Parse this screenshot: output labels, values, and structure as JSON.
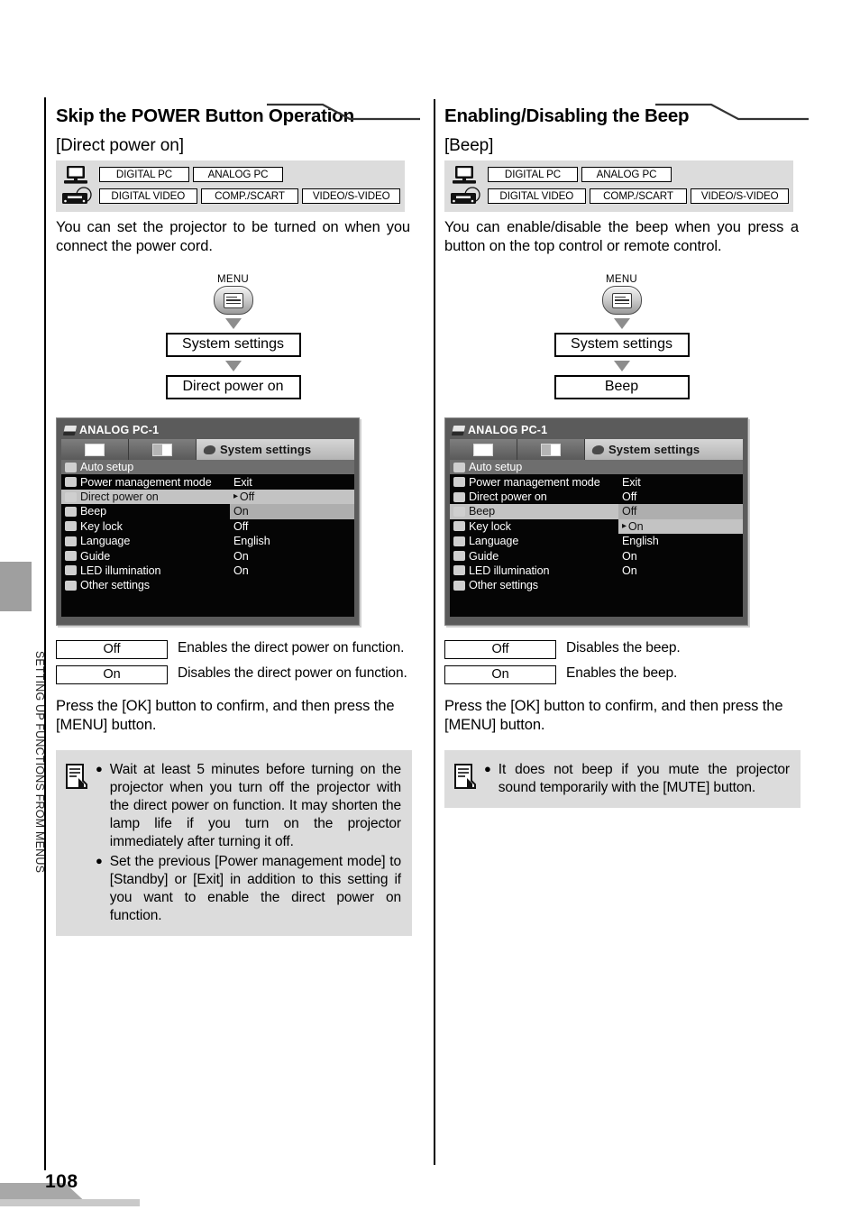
{
  "page": {
    "number": "108",
    "side_label": "SETTING UP FUNCTIONS FROM MENUS"
  },
  "columns": [
    {
      "heading": "Skip the POWER Button Operation",
      "subheading": "[Direct power on]",
      "signals": {
        "pc_icon": "desktop-computer-icon",
        "video_icon": "video-deck-icon",
        "row1": [
          "DIGITAL PC",
          "ANALOG PC"
        ],
        "row2": [
          "DIGITAL VIDEO",
          "COMP./SCART",
          "VIDEO/S-VIDEO"
        ]
      },
      "intro": "You can set the projector to be turned on when you connect the power cord.",
      "flow": {
        "menu_label": "MENU",
        "menu_icon": "menu-button-icon",
        "step1": "System settings",
        "step2": "Direct power on"
      },
      "osd": {
        "title": "ANALOG PC-1",
        "tab_label": "System settings",
        "rows": [
          {
            "label": "Auto setup",
            "value": "",
            "icon": "auto-setup-icon"
          },
          {
            "label": "Power management mode",
            "value": "Exit",
            "icon": "power-management-icon"
          },
          {
            "label": "Direct power on",
            "value": "Off",
            "icon": "direct-power-icon",
            "cursor": "▸",
            "state": "selected-label"
          },
          {
            "label": "Beep",
            "value": "On",
            "icon": "beep-icon",
            "state": "selected-value"
          },
          {
            "label": "Key lock",
            "value": "Off",
            "icon": "key-lock-icon"
          },
          {
            "label": "Language",
            "value": "English",
            "icon": "language-icon"
          },
          {
            "label": "Guide",
            "value": "On",
            "icon": "guide-icon"
          },
          {
            "label": "LED illumination",
            "value": "On",
            "icon": "led-illumination-icon"
          },
          {
            "label": "Other settings",
            "value": "",
            "icon": "other-settings-icon"
          }
        ]
      },
      "options": [
        {
          "key": "Off",
          "desc": "Enables the direct power on function."
        },
        {
          "key": "On",
          "desc": "Disables the direct power on function."
        }
      ],
      "after": "Press the [OK] button to confirm, and then press the [MENU] button.",
      "note_icon": "note-memo-icon",
      "notes": [
        "Wait at least 5 minutes before turning on the projector when you turn off the projector with the direct power on function. It may shorten the lamp life if you turn on the projector immediately after turning it off.",
        "Set the previous [Power management mode] to [Standby] or [Exit] in addition to this setting if you want to enable the direct power on function."
      ],
      "bullet": "●"
    },
    {
      "heading": "Enabling/Disabling the Beep",
      "subheading": "[Beep]",
      "signals": {
        "pc_icon": "desktop-computer-icon",
        "video_icon": "video-deck-icon",
        "row1": [
          "DIGITAL PC",
          "ANALOG PC"
        ],
        "row2": [
          "DIGITAL VIDEO",
          "COMP./SCART",
          "VIDEO/S-VIDEO"
        ]
      },
      "intro": "You can enable/disable the beep when you press a button on the top control or remote control.",
      "flow": {
        "menu_label": "MENU",
        "menu_icon": "menu-button-icon",
        "step1": "System settings",
        "step2": "Beep"
      },
      "osd": {
        "title": "ANALOG PC-1",
        "tab_label": "System settings",
        "rows": [
          {
            "label": "Auto setup",
            "value": "",
            "icon": "auto-setup-icon"
          },
          {
            "label": "Power management mode",
            "value": "Exit",
            "icon": "power-management-icon"
          },
          {
            "label": "Direct power on",
            "value": "Off",
            "icon": "direct-power-icon"
          },
          {
            "label": "Beep",
            "value": "Off",
            "icon": "beep-icon",
            "state": "selected-label"
          },
          {
            "label": "Key lock",
            "value": "On",
            "icon": "key-lock-icon",
            "cursor": "▸",
            "state": "selected-value"
          },
          {
            "label": "Language",
            "value": "English",
            "icon": "language-icon"
          },
          {
            "label": "Guide",
            "value": "On",
            "icon": "guide-icon"
          },
          {
            "label": "LED illumination",
            "value": "On",
            "icon": "led-illumination-icon"
          },
          {
            "label": "Other settings",
            "value": "",
            "icon": "other-settings-icon"
          }
        ]
      },
      "options": [
        {
          "key": "Off",
          "desc": "Disables the beep."
        },
        {
          "key": "On",
          "desc": "Enables the beep."
        }
      ],
      "after": "Press the [OK] button to confirm, and then press the [MENU] button.",
      "note_icon": "note-memo-icon",
      "notes": [
        "It does not beep if you mute the projector sound temporarily with the [MUTE] button."
      ],
      "bullet": "●"
    }
  ]
}
